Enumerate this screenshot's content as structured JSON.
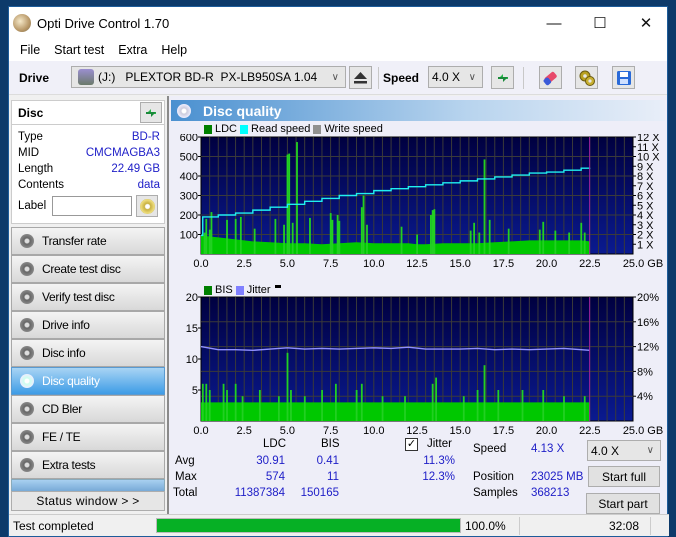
{
  "window": {
    "title": "Opti Drive Control 1.70",
    "controls": [
      "minimize",
      "maximize",
      "close"
    ]
  },
  "menu": [
    "File",
    "Start test",
    "Extra",
    "Help"
  ],
  "toolbar": {
    "drive_label": "Drive",
    "drive_value": "(J:)   PLEXTOR BD-R  PX-LB950SA 1.04",
    "speed_label": "Speed",
    "speed_value": "4.0 X"
  },
  "disc": {
    "heading": "Disc",
    "rows": [
      {
        "label": "Type",
        "value": "BD-R"
      },
      {
        "label": "MID",
        "value": "CMCMAGBA3"
      },
      {
        "label": "Length",
        "value": "22.49 GB"
      },
      {
        "label": "Contents",
        "value": "data"
      }
    ],
    "label_field": "Label",
    "label_value": ""
  },
  "nav": [
    {
      "label": "Transfer rate",
      "active": false
    },
    {
      "label": "Create test disc",
      "active": false
    },
    {
      "label": "Verify test disc",
      "active": false
    },
    {
      "label": "Drive info",
      "active": false
    },
    {
      "label": "Disc info",
      "active": false
    },
    {
      "label": "Disc quality",
      "active": true
    },
    {
      "label": "CD Bler",
      "active": false
    },
    {
      "label": "FE / TE",
      "active": false
    },
    {
      "label": "Extra tests",
      "active": false
    }
  ],
  "status_window_label": "Status window > >",
  "panel_title": "Disc quality",
  "chart_data": [
    {
      "type": "bar",
      "title": "LDC / Read speed",
      "legend": [
        "LDC",
        "Read speed",
        "Write speed"
      ],
      "legend_colors": {
        "LDC": "#00a000",
        "Read speed": "#00ffff",
        "Write speed": "#a0a0a0"
      },
      "xlabel": "GB",
      "x_ticks": [
        "0.0",
        "2.5",
        "5.0",
        "7.5",
        "10.0",
        "12.5",
        "15.0",
        "17.5",
        "20.0",
        "22.5",
        "25.0 GB"
      ],
      "xlim": [
        0,
        25
      ],
      "y_left_ticks": [
        "100",
        "200",
        "300",
        "400",
        "500",
        "600"
      ],
      "ylim_left": [
        0,
        600
      ],
      "y_right_ticks": [
        "1 X",
        "2 X",
        "3 X",
        "4 X",
        "5 X",
        "6 X",
        "7 X",
        "8 X",
        "9 X",
        "10 X",
        "11 X",
        "12 X"
      ],
      "ylim_right": [
        0,
        12
      ],
      "end_marker_gb": 22.49,
      "ldc_baseline": [
        [
          0.0,
          95
        ],
        [
          1.0,
          85
        ],
        [
          2.0,
          75
        ],
        [
          3.0,
          65
        ],
        [
          4.0,
          60
        ],
        [
          5.0,
          55
        ],
        [
          6.0,
          55
        ],
        [
          7.0,
          50
        ],
        [
          8.0,
          55
        ],
        [
          9.0,
          60
        ],
        [
          10.0,
          55
        ],
        [
          11.0,
          55
        ],
        [
          12.0,
          55
        ],
        [
          12.5,
          50
        ],
        [
          13.0,
          50
        ],
        [
          14.0,
          55
        ],
        [
          15.0,
          55
        ],
        [
          16.0,
          55
        ],
        [
          17.0,
          60
        ],
        [
          18.0,
          65
        ],
        [
          19.0,
          70
        ],
        [
          20.0,
          70
        ],
        [
          21.0,
          70
        ],
        [
          22.0,
          70
        ],
        [
          22.49,
          65
        ]
      ],
      "ldc_spikes": [
        [
          0.2,
          110
        ],
        [
          0.3,
          180
        ],
        [
          0.5,
          125
        ],
        [
          0.6,
          215
        ],
        [
          1.5,
          175
        ],
        [
          2.0,
          180
        ],
        [
          2.3,
          190
        ],
        [
          3.1,
          130
        ],
        [
          4.3,
          180
        ],
        [
          4.8,
          150
        ],
        [
          5.0,
          510
        ],
        [
          5.1,
          515
        ],
        [
          5.3,
          160
        ],
        [
          5.55,
          574
        ],
        [
          6.3,
          185
        ],
        [
          7.5,
          210
        ],
        [
          7.6,
          175
        ],
        [
          7.9,
          200
        ],
        [
          8.0,
          170
        ],
        [
          9.3,
          240
        ],
        [
          9.4,
          300
        ],
        [
          9.6,
          150
        ],
        [
          11.6,
          140
        ],
        [
          12.5,
          100
        ],
        [
          13.3,
          200
        ],
        [
          13.4,
          225
        ],
        [
          13.5,
          230
        ],
        [
          15.6,
          120
        ],
        [
          15.8,
          160
        ],
        [
          16.1,
          110
        ],
        [
          16.4,
          485
        ],
        [
          16.7,
          175
        ],
        [
          17.8,
          130
        ],
        [
          19.6,
          125
        ],
        [
          19.8,
          165
        ],
        [
          20.5,
          120
        ],
        [
          21.3,
          110
        ],
        [
          22.0,
          160
        ],
        [
          22.2,
          110
        ]
      ],
      "read_speed": [
        [
          0.0,
          1.9
        ],
        [
          0.1,
          3.8
        ],
        [
          1.0,
          4.0
        ],
        [
          2.0,
          4.2
        ],
        [
          3.0,
          4.5
        ],
        [
          4.0,
          4.8
        ],
        [
          5.0,
          5.1
        ],
        [
          6.0,
          5.4
        ],
        [
          7.0,
          5.7
        ],
        [
          8.0,
          6.0
        ],
        [
          9.0,
          6.2
        ],
        [
          10.0,
          6.5
        ],
        [
          11.0,
          6.7
        ],
        [
          12.0,
          6.9
        ],
        [
          13.0,
          7.1
        ],
        [
          14.0,
          7.3
        ],
        [
          15.0,
          7.5
        ],
        [
          16.0,
          7.7
        ],
        [
          17.0,
          7.9
        ],
        [
          18.0,
          8.1
        ],
        [
          19.0,
          8.3
        ],
        [
          20.0,
          8.4
        ],
        [
          21.0,
          8.6
        ],
        [
          22.0,
          8.8
        ],
        [
          22.49,
          8.85
        ]
      ]
    },
    {
      "type": "bar",
      "title": "BIS / Jitter",
      "legend": [
        "BIS",
        "Jitter"
      ],
      "legend_colors": {
        "BIS": "#00a000",
        "Jitter": "#8080ff"
      },
      "xlabel": "GB",
      "x_ticks": [
        "0.0",
        "2.5",
        "5.0",
        "7.5",
        "10.0",
        "12.5",
        "15.0",
        "17.5",
        "20.0",
        "22.5",
        "25.0 GB"
      ],
      "xlim": [
        0,
        25
      ],
      "y_left_ticks": [
        "5",
        "10",
        "15",
        "20"
      ],
      "ylim_left": [
        0,
        20
      ],
      "y_right_ticks": [
        "4%",
        "8%",
        "12%",
        "16%",
        "20%"
      ],
      "ylim_right": [
        0,
        20
      ],
      "end_marker_gb": 22.49,
      "bis_baseline": [
        [
          0.0,
          3
        ],
        [
          22.49,
          3
        ]
      ],
      "bis_spikes": [
        [
          0.1,
          6
        ],
        [
          0.3,
          6
        ],
        [
          0.5,
          5
        ],
        [
          1.3,
          6
        ],
        [
          1.5,
          5
        ],
        [
          2.0,
          6
        ],
        [
          2.4,
          4
        ],
        [
          3.4,
          5
        ],
        [
          4.5,
          4
        ],
        [
          5.0,
          11
        ],
        [
          5.2,
          5
        ],
        [
          6.0,
          4
        ],
        [
          7.0,
          5
        ],
        [
          7.8,
          6
        ],
        [
          9.0,
          5
        ],
        [
          9.3,
          6
        ],
        [
          10.5,
          4
        ],
        [
          11.8,
          4
        ],
        [
          13.4,
          6
        ],
        [
          13.6,
          7
        ],
        [
          15.2,
          4
        ],
        [
          16.0,
          5
        ],
        [
          16.4,
          9
        ],
        [
          17.2,
          5
        ],
        [
          18.6,
          5
        ],
        [
          19.8,
          5
        ],
        [
          21.0,
          4
        ],
        [
          22.2,
          4
        ]
      ],
      "jitter_pct": [
        [
          0.0,
          12.0
        ],
        [
          1.0,
          11.5
        ],
        [
          2.0,
          11.5
        ],
        [
          3.0,
          11.4
        ],
        [
          4.0,
          11.6
        ],
        [
          5.0,
          11.8
        ],
        [
          6.0,
          11.6
        ],
        [
          7.0,
          11.7
        ],
        [
          8.0,
          11.6
        ],
        [
          9.0,
          11.7
        ],
        [
          10.0,
          11.8
        ],
        [
          11.0,
          11.7
        ],
        [
          12.0,
          11.9
        ],
        [
          13.0,
          11.6
        ],
        [
          14.0,
          11.6
        ],
        [
          15.0,
          11.6
        ],
        [
          16.0,
          11.7
        ],
        [
          17.0,
          11.5
        ],
        [
          18.0,
          11.6
        ],
        [
          19.0,
          11.5
        ],
        [
          20.0,
          11.6
        ],
        [
          21.0,
          11.7
        ],
        [
          22.0,
          11.5
        ],
        [
          22.49,
          11.4
        ]
      ]
    }
  ],
  "stats": {
    "headers": {
      "ldc": "LDC",
      "bis": "BIS",
      "jitter": "Jitter"
    },
    "jitter_checked": true,
    "rows": [
      {
        "label": "Avg",
        "ldc": "30.91",
        "bis": "0.41",
        "jitter": "11.3%"
      },
      {
        "label": "Max",
        "ldc": "574",
        "bis": "11",
        "jitter": "12.3%"
      },
      {
        "label": "Total",
        "ldc": "11387384",
        "bis": "150165",
        "jitter": ""
      }
    ],
    "speed_label": "Speed",
    "speed_value": "4.13 X",
    "position_label": "Position",
    "position_value": "23025 MB",
    "samples_label": "Samples",
    "samples_value": "368213",
    "speed_select": "4.0 X",
    "start_full": "Start full",
    "start_part": "Start part"
  },
  "statusbar": {
    "text": "Test completed",
    "progress_pct": 100.0,
    "progress_label": "100.0%",
    "time": "32:08"
  }
}
